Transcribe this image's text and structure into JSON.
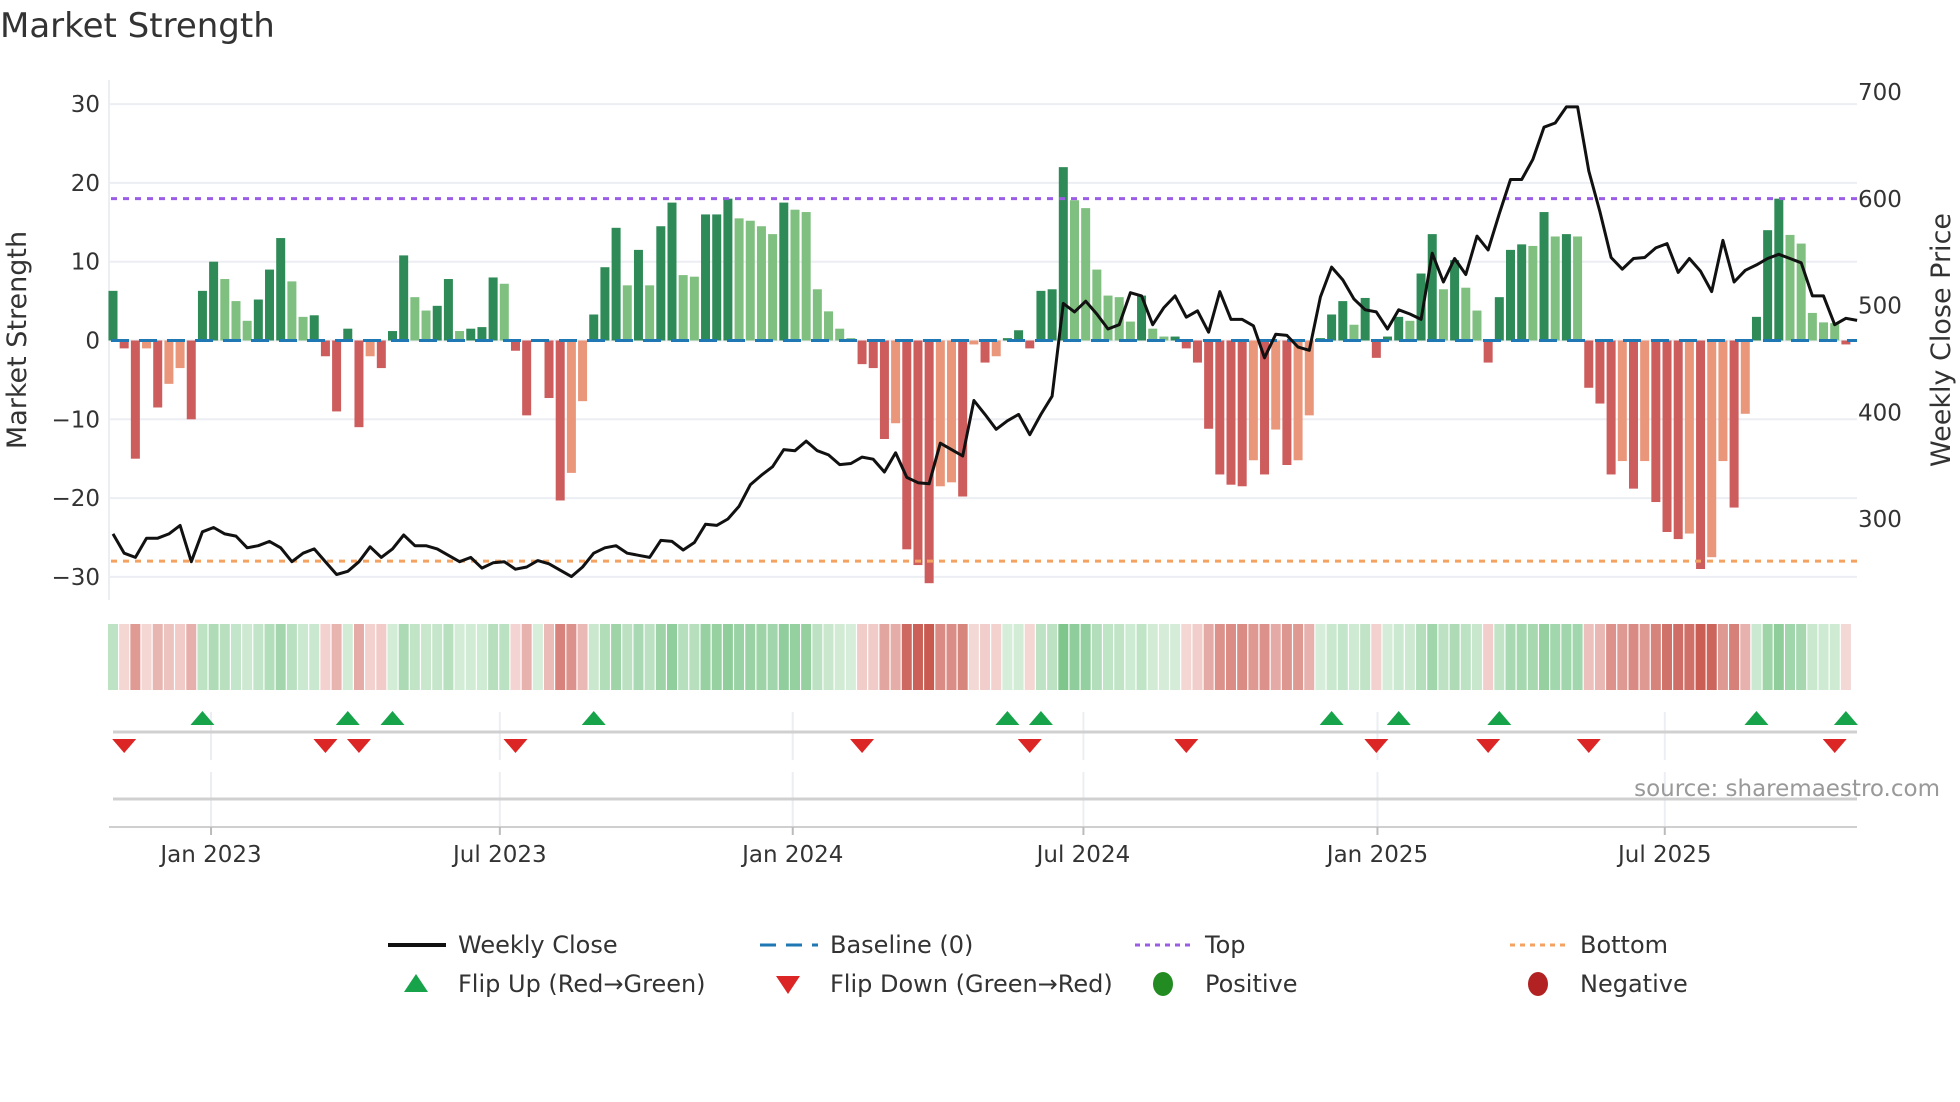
{
  "chart_data": {
    "type": "bar",
    "title": "Market Strength",
    "ylabel": "Market Strength",
    "y2label": "Weekly Close Price",
    "ylim": [
      -33,
      33
    ],
    "y2lim": [
      230,
      715
    ],
    "yticks": [
      30,
      20,
      10,
      0,
      -10,
      -20,
      -30
    ],
    "y2ticks": [
      700,
      600,
      500,
      400,
      300
    ],
    "start_week": "2022-11-04",
    "frequency": "weekly",
    "xticks": [
      {
        "label": "Jan 2023",
        "week": 8.77
      },
      {
        "label": "Jul 2023",
        "week": 34.6
      },
      {
        "label": "Jan 2024",
        "week": 60.8
      },
      {
        "label": "Jul 2024",
        "week": 86.8
      },
      {
        "label": "Jan 2025",
        "week": 113.1
      },
      {
        "label": "Jul 2025",
        "week": 138.8
      }
    ],
    "top_level": 18,
    "bottom_level": -28,
    "baseline": 0,
    "strength": [
      6.3,
      -1,
      -15,
      -1,
      -8.5,
      -5.5,
      -3.5,
      -10,
      6.3,
      10,
      7.8,
      5,
      2.5,
      5.2,
      9,
      13,
      7.5,
      3,
      3.2,
      -2,
      -9,
      1.5,
      -11,
      -2,
      -3.5,
      1.2,
      10.8,
      5.5,
      3.8,
      4.4,
      7.8,
      1.2,
      1.5,
      1.7,
      8,
      7.2,
      -1.3,
      -9.5,
      0.1,
      -7.3,
      -20.3,
      -16.8,
      -7.7,
      3.3,
      9.3,
      14.3,
      7,
      11.5,
      7,
      14.5,
      17.5,
      8.3,
      8.1,
      16,
      16,
      18,
      15.5,
      15.2,
      14.5,
      13.5,
      17.5,
      16.6,
      16.3,
      6.5,
      3.7,
      1.5,
      0.3,
      -3,
      -3.5,
      -12.5,
      -10.5,
      -26.5,
      -28.5,
      -30.8,
      -18.5,
      -18,
      -19.8,
      -0.5,
      -2.8,
      -2,
      0.3,
      1.3,
      -1,
      6.3,
      6.5,
      22,
      17.8,
      16.8,
      9,
      5.7,
      5.5,
      2.4,
      5.7,
      1.5,
      0.5,
      0.5,
      -1,
      -2.8,
      -11.2,
      -17,
      -18.3,
      -18.5,
      -15.2,
      -17,
      -11.3,
      -15.8,
      -15.2,
      -9.5,
      0.3,
      3.3,
      5,
      2,
      5.4,
      -2.2,
      0.5,
      3,
      2.5,
      8.5,
      13.5,
      6.5,
      10.2,
      6.7,
      3.8,
      -2.8,
      5.5,
      11.5,
      12.2,
      12,
      16.3,
      13.2,
      13.5,
      13.2,
      -6,
      -8,
      -17,
      -15.3,
      -18.8,
      -15.3,
      -20.5,
      -24.3,
      -25.2,
      -24.5,
      -29,
      -27.5,
      -15.3,
      -21.2,
      -9.3,
      3,
      14,
      18,
      13.4,
      12.3,
      3.5,
      2.3,
      2.2,
      -0.5
    ],
    "weekly_close": [
      286,
      268,
      264,
      282,
      282,
      286,
      294,
      260,
      288,
      292,
      286,
      284,
      273,
      275,
      279,
      273,
      260,
      268,
      272,
      260,
      248,
      251,
      260,
      274,
      264,
      272,
      285,
      275,
      275,
      272,
      266,
      260,
      264,
      254,
      259,
      260,
      253,
      255,
      261,
      258,
      252,
      246,
      255,
      268,
      273,
      275,
      268,
      266,
      264,
      280,
      279,
      271,
      278,
      295,
      294,
      300,
      312,
      332,
      341,
      349,
      365,
      364,
      373,
      364,
      360,
      351,
      352,
      358,
      356,
      344,
      362,
      339,
      334,
      333,
      371,
      365,
      359,
      411,
      398,
      384,
      392,
      398,
      379,
      398,
      415,
      502,
      494,
      504,
      492,
      478,
      482,
      512,
      509,
      482,
      498,
      509,
      489,
      495,
      475,
      513,
      487,
      487,
      481,
      451,
      473,
      472,
      461,
      458,
      508,
      536,
      524,
      506,
      496,
      494,
      478,
      496,
      492,
      487,
      549,
      522,
      544,
      529,
      565,
      552,
      586,
      618,
      618,
      637,
      667,
      671,
      686,
      686,
      626,
      588,
      545,
      534,
      544,
      545,
      554,
      558,
      531,
      544,
      532,
      513,
      561,
      522,
      533,
      538,
      544,
      548,
      544,
      540,
      509,
      509,
      482,
      488,
      486
    ],
    "flip_up_weeks": [
      8,
      21,
      25,
      43,
      80,
      83,
      109,
      115,
      124,
      147,
      155
    ],
    "flip_down_weeks": [
      1,
      19,
      22,
      36,
      67,
      82,
      96,
      113,
      123,
      132,
      154
    ],
    "legend": [
      {
        "label": "Weekly Close",
        "kind": "line",
        "color": "#111111"
      },
      {
        "label": "Baseline (0)",
        "kind": "dash",
        "color": "#1f77b4"
      },
      {
        "label": "Top",
        "kind": "dot",
        "color": "#9b5de5"
      },
      {
        "label": "Bottom",
        "kind": "dot",
        "color": "#f4a261"
      },
      {
        "label": "Flip Up (Red→Green)",
        "kind": "up",
        "color": "#16a34a"
      },
      {
        "label": "Flip Down (Green→Red)",
        "kind": "down",
        "color": "#dc2626"
      },
      {
        "label": "Positive",
        "kind": "circle",
        "color": "#228b22"
      },
      {
        "label": "Negative",
        "kind": "circle",
        "color": "#b22222"
      }
    ],
    "legend_position": "bottom",
    "source": "source: sharemaestro.com",
    "colors": {
      "pos_strong": "#2e8b57",
      "pos_weak": "#7fbf7f",
      "neg_strong": "#cd5c5c",
      "neg_weak": "#e9967a"
    }
  }
}
